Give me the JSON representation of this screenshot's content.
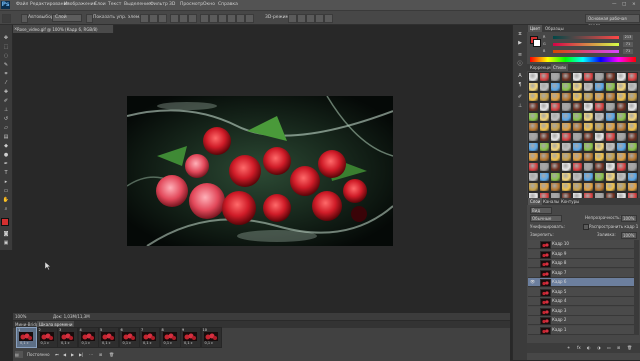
{
  "app": {
    "logo": "Ps"
  },
  "menu": [
    "Файл",
    "Редактирование",
    "Изображение",
    "Слои",
    "Текст",
    "Выделение",
    "Фильтр",
    "3D",
    "Просмотр",
    "Окно",
    "Справка"
  ],
  "options": {
    "autoselect_label": "Автовыбор:",
    "autoselect_value": "Слой",
    "show_controls_label": "Показать упр. элем.",
    "mode_3d_label": "3D-режим:",
    "workspace_value": "Основная рабочая среда"
  },
  "document": {
    "tab_title": "Rose_video.gif @ 100% (Кадр 6, RGB/8)",
    "close": "×"
  },
  "status": {
    "zoom": "100%",
    "doc_size": "Док: 1,03M/11,3M"
  },
  "animation": {
    "tabs": [
      "Мини-Bridge",
      "Шкала времени"
    ],
    "frames": [
      {
        "num": "1",
        "delay": "0,1 с"
      },
      {
        "num": "2",
        "delay": "0,1 с"
      },
      {
        "num": "3",
        "delay": "0,1 с"
      },
      {
        "num": "4",
        "delay": "0,1 с"
      },
      {
        "num": "5",
        "delay": "0,1 с"
      },
      {
        "num": "6",
        "delay": "0,1 с"
      },
      {
        "num": "7",
        "delay": "0,1 с"
      },
      {
        "num": "8",
        "delay": "0,1 с"
      },
      {
        "num": "9",
        "delay": "0,1 с"
      },
      {
        "num": "10",
        "delay": "0,1 с"
      }
    ],
    "loop_value": "Постоянно",
    "control_icons": [
      "first-frame-icon",
      "prev-frame-icon",
      "play-icon",
      "next-frame-icon",
      "tween-icon",
      "new-frame-icon",
      "delete-frame-icon"
    ]
  },
  "color_panel": {
    "tabs": [
      "Цвет",
      "Образцы"
    ],
    "channels": [
      "R",
      "G",
      "B"
    ],
    "values": [
      "213",
      "71",
      "71"
    ]
  },
  "styles_panel": {
    "tabs": [
      "Коррекция",
      "Стили"
    ]
  },
  "layers_panel": {
    "tabs": [
      "Слои",
      "Каналы",
      "Контуры"
    ],
    "filter_label": "Вид",
    "blend_mode": "Обычные",
    "opacity_label": "Непрозрачность:",
    "opacity_value": "100%",
    "unify_label": "Унифицировать:",
    "propagate_label": "Распространить кадр 1",
    "lock_label": "Закрепить:",
    "fill_label": "Заливка:",
    "fill_value": "100%",
    "layers": [
      {
        "name": "Кадр 10",
        "visible": false
      },
      {
        "name": "Кадр 9",
        "visible": false
      },
      {
        "name": "Кадр 8",
        "visible": false
      },
      {
        "name": "Кадр 7",
        "visible": false
      },
      {
        "name": "Кадр 6",
        "visible": true
      },
      {
        "name": "Кадр 5",
        "visible": false
      },
      {
        "name": "Кадр 4",
        "visible": false
      },
      {
        "name": "Кадр 3",
        "visible": false
      },
      {
        "name": "Кадр 2",
        "visible": false
      },
      {
        "name": "Кадр 1",
        "visible": false
      }
    ],
    "selected_layer": "Кадр 6"
  },
  "colors": {
    "foreground": "#d43030",
    "background": "#ffffff",
    "accent": "#5d6f86"
  }
}
